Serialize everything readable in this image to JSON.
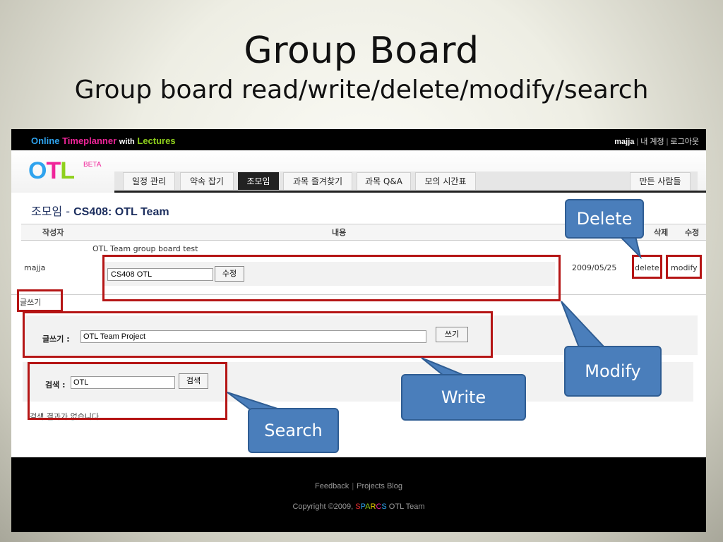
{
  "slide": {
    "title": "Group Board",
    "subtitle": "Group board read/write/delete/modify/search"
  },
  "site": {
    "brand_online": "Online",
    "brand_timeplanner": "Timeplanner",
    "brand_with": "with",
    "brand_lectures": "Lectures",
    "username": "majja",
    "account_link": "내 계정",
    "logout_link": "로그아웃",
    "logo_o": "O",
    "logo_t": "T",
    "logo_l": "L",
    "beta": "BETA"
  },
  "tabs": [
    "일정 관리",
    "약속 잡기",
    "조모임",
    "과목 즐겨찾기",
    "과목 Q&A",
    "모의 시간표"
  ],
  "tab_right": "만든 사람들",
  "page": {
    "title_prefix": "조모임 - ",
    "title_course": "CS408: OTL Team"
  },
  "table": {
    "col_author": "작성자",
    "col_content": "내용",
    "col_delete": "삭제",
    "col_edit": "수정"
  },
  "post": {
    "title": "OTL Team group board test",
    "author": "majja",
    "edit_value": "CS408 OTL",
    "edit_button": "수정",
    "date": "2009/05/25",
    "delete_link": "delete",
    "modify_link": "modify"
  },
  "write": {
    "link": "글쓰기",
    "label": "글쓰기 :",
    "value": "OTL Team Project",
    "button": "쓰기"
  },
  "search": {
    "label": "검색 :",
    "value": "OTL",
    "button": "검색",
    "no_results": "검색 결과가 없습니다."
  },
  "footer": {
    "feedback": "Feedback",
    "projects_blog": "Projects Blog",
    "copyright": "Copyright ©2009,",
    "sparcs": [
      "S",
      "P",
      "A",
      "R",
      "C",
      "S"
    ],
    "team": "OTL Team"
  },
  "callouts": {
    "delete": "Delete",
    "modify": "Modify",
    "write": "Write",
    "search": "Search"
  },
  "colors": {
    "annotation_red": "#b51515",
    "callout_blue": "#4a7ebb",
    "title_navy": "#1c2e5e"
  }
}
